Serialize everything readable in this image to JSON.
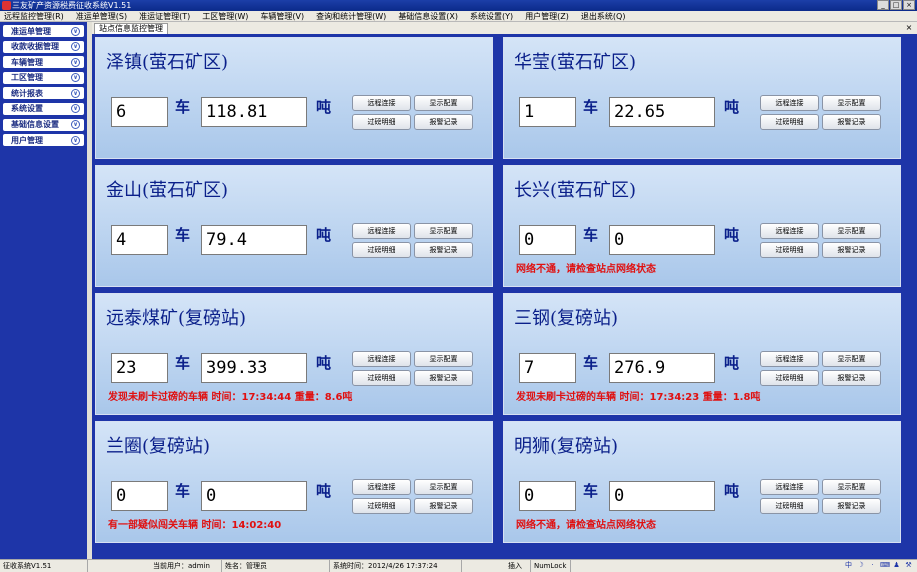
{
  "window": {
    "title": "三友矿产资源税费征收系统V1.51",
    "minimize": "_",
    "maximize": "□",
    "close": "×"
  },
  "menu": [
    "远程监控管理(R)",
    "准运单管理(S)",
    "准运证管理(T)",
    "工区管理(W)",
    "车辆管理(V)",
    "查询和统计管理(W)",
    "基础信息设置(X)",
    "系统设置(Y)",
    "用户管理(Z)",
    "退出系统(Q)"
  ],
  "sidebar": [
    "准运单管理",
    "收款收据管理",
    "车辆管理",
    "工区管理",
    "统计报表",
    "系统设置",
    "基础信息设置",
    "用户管理"
  ],
  "tab": {
    "label": "站点信息监控管理",
    "close": "×"
  },
  "units": {
    "car": "车",
    "ton": "吨"
  },
  "buttons": {
    "remote": "远程连接",
    "display": "显示配置",
    "weigh": "过磅明细",
    "alarm": "报警记录"
  },
  "stations": [
    {
      "name": "泽镇(萤石矿区)",
      "count": "6",
      "weight": "118.81",
      "alert": ""
    },
    {
      "name": "华莹(萤石矿区)",
      "count": "1",
      "weight": "22.65",
      "alert": ""
    },
    {
      "name": "金山(萤石矿区)",
      "count": "4",
      "weight": "79.4",
      "alert": ""
    },
    {
      "name": "长兴(萤石矿区)",
      "count": "0",
      "weight": "0",
      "alert": "网络不通，请检查站点网络状态"
    },
    {
      "name": "远泰煤矿(复磅站)",
      "count": "23",
      "weight": "399.33",
      "alert": "发现未刷卡过磅的车辆 时间：17:34:44 重量：8.6吨"
    },
    {
      "name": "三钢(复磅站)",
      "count": "7",
      "weight": "276.9",
      "alert": "发现未刷卡过磅的车辆 时间：17:34:23 重量：1.8吨"
    },
    {
      "name": "兰圈(复磅站)",
      "count": "0",
      "weight": "0",
      "alert": "有一部疑似闯关车辆 时间：14:02:40"
    },
    {
      "name": "明狮(复磅站)",
      "count": "0",
      "weight": "0",
      "alert": "网络不通，请检查站点网络状态"
    }
  ],
  "status": {
    "app": "征收系统V1.51",
    "user": "当前用户：admin",
    "name": "姓名：管理员",
    "time": "系统时间：2012/4/26 17:37:24",
    "insert": "插入",
    "numlock": "NumLock",
    "ime": "中"
  }
}
